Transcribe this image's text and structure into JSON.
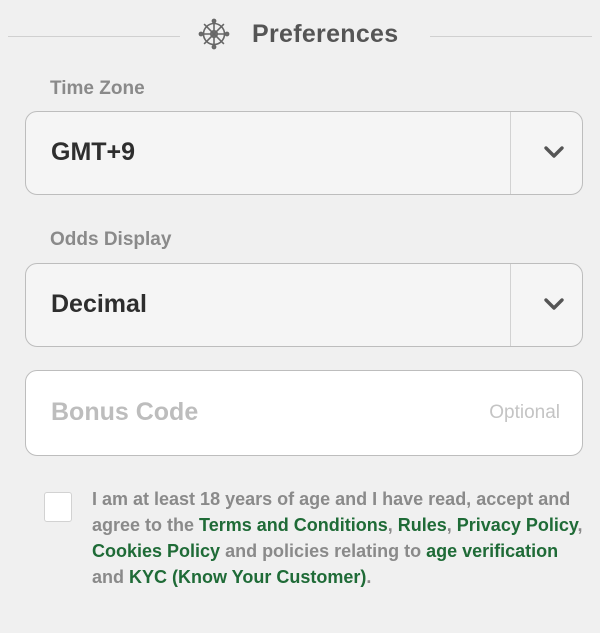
{
  "header": {
    "title": "Preferences",
    "icon": "gear-icon"
  },
  "time_zone": {
    "label": "Time Zone",
    "value": "GMT+9"
  },
  "odds_display": {
    "label": "Odds Display",
    "value": "Decimal"
  },
  "bonus_code": {
    "placeholder": "Bonus Code",
    "hint": "Optional"
  },
  "consent": {
    "checked": false,
    "text_1": "I am at least 18 years of age and I have read, accept and agree to the ",
    "link_terms": "Terms and Conditions",
    "sep_1": ", ",
    "link_rules": "Rules",
    "sep_2": ", ",
    "link_privacy": "Privacy Policy",
    "sep_3": ", ",
    "link_cookies": "Cookies Policy",
    "text_2": " and policies relating to ",
    "link_age": "age verification",
    "text_3": " and ",
    "link_kyc": "KYC (Know Your Customer)",
    "text_4": "."
  },
  "colors": {
    "background": "#f0f0f0",
    "link": "#1f6b37",
    "label": "#8a8a8a",
    "value": "#2e2e2e"
  }
}
